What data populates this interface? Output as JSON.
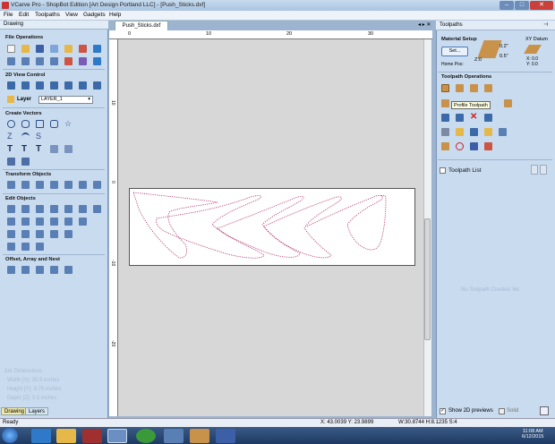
{
  "window": {
    "title": "VCarve Pro - ShopBot Edition [Art Design Portland LLC] - [Push_Sticks.dxf]",
    "min": "–",
    "max": "□",
    "close": "✕"
  },
  "menu": [
    "File",
    "Edit",
    "Toolpaths",
    "View",
    "Gadgets",
    "Help"
  ],
  "left_panel": {
    "header": "Drawing",
    "sections": {
      "file_ops": "File Operations",
      "view_control": "2D View Control",
      "create_vectors": "Create Vectors",
      "transform": "Transform Objects",
      "edit_objects": "Edit Objects",
      "offset": "Offset, Array and Nest"
    },
    "layer_label": "Layer",
    "layer_value": "LAYER_1",
    "job_dimensions": {
      "title": "Job Dimensions",
      "width": "Width  [X]: 35.5 inches",
      "height": "Height [Y]: 9.75 inches",
      "depth": "Depth  [Z]: 0.5 inches"
    },
    "tabs": [
      "Drawing",
      "Layers"
    ]
  },
  "document": {
    "tab": "Push_Sticks.dxf",
    "ruler_top": [
      "0",
      "10",
      "20",
      "30"
    ],
    "ruler_left": [
      "10",
      "0",
      "-10",
      "-20"
    ]
  },
  "right_panel": {
    "header": "Toolpaths",
    "material_setup": "Material Setup",
    "set_button": "Set...",
    "xy_datum": "XY Datum",
    "z_val": "Z:0",
    "thickness": "0.5\"",
    "top_val": "0.2\"",
    "home_pos": "Home Pos:",
    "datum_vals": "X: 0.0\nY: 0.0",
    "toolpath_ops": "Toolpath Operations",
    "tooltip": "Profile Toolpath",
    "toolpath_list": "Toolpath List",
    "no_toolpath": "No Toolpath Created Yet",
    "show_2d": "Show 2D previews",
    "solid": "Solid"
  },
  "status": {
    "ready": "Ready",
    "xy": "X: 43.0039 Y: 23.9899",
    "wh": "W:30.8744  H:8.1235  S:4"
  },
  "taskbar": {
    "time": "11:08 AM",
    "date": "6/12/2015"
  }
}
